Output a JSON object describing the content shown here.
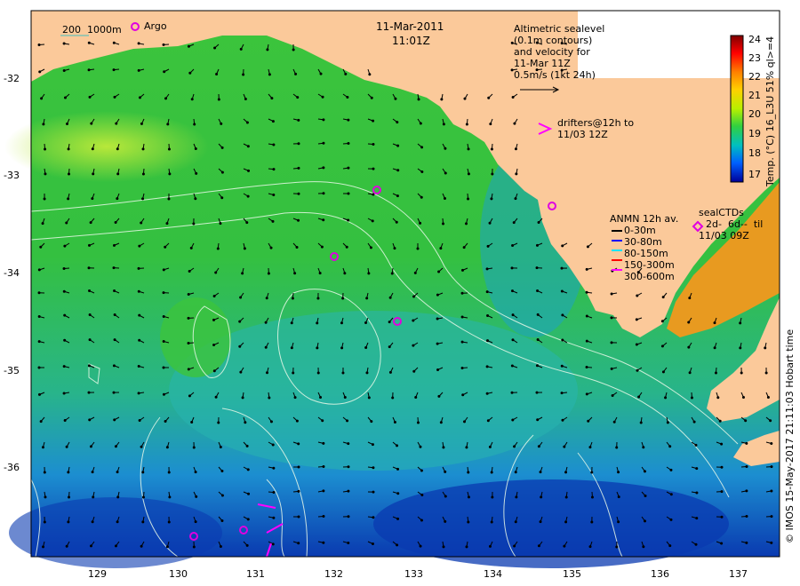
{
  "map": {
    "date": "11-Mar-2011",
    "time": "11:01Z",
    "bathy_legend": {
      "depth1": "200",
      "depth2": "1000m"
    },
    "argo_label": "Argo",
    "altimetry_lines": [
      "Altimetric sealevel",
      "(0.1m contours)",
      "and velocity for",
      "11-Mar 11Z",
      "0.5m/s (1kt 24h)"
    ],
    "drifters_lines": [
      "drifters@12h to",
      "11/03 12Z"
    ],
    "anmn_title": "ANMN 12h av.",
    "anmn_depths": [
      {
        "label": "0-30m",
        "color": "#000000"
      },
      {
        "label": "30-80m",
        "color": "#0000ff"
      },
      {
        "label": "80-150m",
        "color": "#00e5ff"
      },
      {
        "label": "150-300m",
        "color": "#ff0000"
      },
      {
        "label": "300-600m",
        "color": "#ff00ff"
      }
    ],
    "sealctd_lines": [
      "sealCTDs",
      "2d-  6d--  til",
      "11/03 09Z"
    ],
    "lat_ticks": [
      "-32",
      "-33",
      "-34",
      "-35",
      "-36"
    ],
    "lon_ticks": [
      "129",
      "130",
      "131",
      "132",
      "133",
      "134",
      "135",
      "136",
      "137"
    ],
    "colorbar": {
      "title": "Temp. (°C) 16_L3U 51% ql>=4",
      "ticks": [
        "24",
        "23",
        "22",
        "21",
        "20",
        "19",
        "18",
        "17"
      ],
      "colors": [
        "#7f0000",
        "#ff0000",
        "#ff8000",
        "#ffd000",
        "#c8f000",
        "#40d040",
        "#00c0c0",
        "#0060ff",
        "#0000a0"
      ]
    },
    "credit": "© IMOS 15-May-2017 21:11:03 Hobart time",
    "colors": {
      "land": "#fbc99a",
      "sst_warm": "#e89a20",
      "sst_green": "#33c433",
      "sst_cyan": "#20b0d0",
      "sst_blue": "#0a3ab0",
      "marker": "#e000e0"
    }
  }
}
